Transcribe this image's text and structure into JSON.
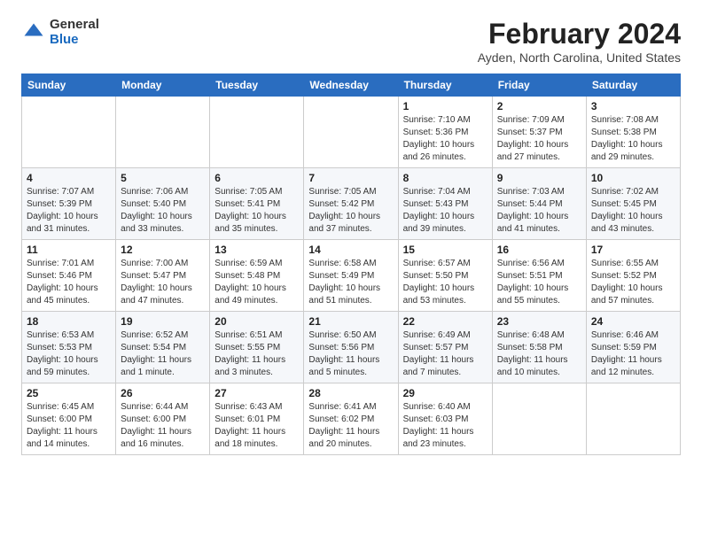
{
  "logo": {
    "general": "General",
    "blue": "Blue"
  },
  "title": "February 2024",
  "subtitle": "Ayden, North Carolina, United States",
  "days_of_week": [
    "Sunday",
    "Monday",
    "Tuesday",
    "Wednesday",
    "Thursday",
    "Friday",
    "Saturday"
  ],
  "weeks": [
    [
      {
        "day": "",
        "sunrise": "",
        "sunset": "",
        "daylight": ""
      },
      {
        "day": "",
        "sunrise": "",
        "sunset": "",
        "daylight": ""
      },
      {
        "day": "",
        "sunrise": "",
        "sunset": "",
        "daylight": ""
      },
      {
        "day": "",
        "sunrise": "",
        "sunset": "",
        "daylight": ""
      },
      {
        "day": "1",
        "sunrise": "Sunrise: 7:10 AM",
        "sunset": "Sunset: 5:36 PM",
        "daylight": "Daylight: 10 hours and 26 minutes."
      },
      {
        "day": "2",
        "sunrise": "Sunrise: 7:09 AM",
        "sunset": "Sunset: 5:37 PM",
        "daylight": "Daylight: 10 hours and 27 minutes."
      },
      {
        "day": "3",
        "sunrise": "Sunrise: 7:08 AM",
        "sunset": "Sunset: 5:38 PM",
        "daylight": "Daylight: 10 hours and 29 minutes."
      }
    ],
    [
      {
        "day": "4",
        "sunrise": "Sunrise: 7:07 AM",
        "sunset": "Sunset: 5:39 PM",
        "daylight": "Daylight: 10 hours and 31 minutes."
      },
      {
        "day": "5",
        "sunrise": "Sunrise: 7:06 AM",
        "sunset": "Sunset: 5:40 PM",
        "daylight": "Daylight: 10 hours and 33 minutes."
      },
      {
        "day": "6",
        "sunrise": "Sunrise: 7:05 AM",
        "sunset": "Sunset: 5:41 PM",
        "daylight": "Daylight: 10 hours and 35 minutes."
      },
      {
        "day": "7",
        "sunrise": "Sunrise: 7:05 AM",
        "sunset": "Sunset: 5:42 PM",
        "daylight": "Daylight: 10 hours and 37 minutes."
      },
      {
        "day": "8",
        "sunrise": "Sunrise: 7:04 AM",
        "sunset": "Sunset: 5:43 PM",
        "daylight": "Daylight: 10 hours and 39 minutes."
      },
      {
        "day": "9",
        "sunrise": "Sunrise: 7:03 AM",
        "sunset": "Sunset: 5:44 PM",
        "daylight": "Daylight: 10 hours and 41 minutes."
      },
      {
        "day": "10",
        "sunrise": "Sunrise: 7:02 AM",
        "sunset": "Sunset: 5:45 PM",
        "daylight": "Daylight: 10 hours and 43 minutes."
      }
    ],
    [
      {
        "day": "11",
        "sunrise": "Sunrise: 7:01 AM",
        "sunset": "Sunset: 5:46 PM",
        "daylight": "Daylight: 10 hours and 45 minutes."
      },
      {
        "day": "12",
        "sunrise": "Sunrise: 7:00 AM",
        "sunset": "Sunset: 5:47 PM",
        "daylight": "Daylight: 10 hours and 47 minutes."
      },
      {
        "day": "13",
        "sunrise": "Sunrise: 6:59 AM",
        "sunset": "Sunset: 5:48 PM",
        "daylight": "Daylight: 10 hours and 49 minutes."
      },
      {
        "day": "14",
        "sunrise": "Sunrise: 6:58 AM",
        "sunset": "Sunset: 5:49 PM",
        "daylight": "Daylight: 10 hours and 51 minutes."
      },
      {
        "day": "15",
        "sunrise": "Sunrise: 6:57 AM",
        "sunset": "Sunset: 5:50 PM",
        "daylight": "Daylight: 10 hours and 53 minutes."
      },
      {
        "day": "16",
        "sunrise": "Sunrise: 6:56 AM",
        "sunset": "Sunset: 5:51 PM",
        "daylight": "Daylight: 10 hours and 55 minutes."
      },
      {
        "day": "17",
        "sunrise": "Sunrise: 6:55 AM",
        "sunset": "Sunset: 5:52 PM",
        "daylight": "Daylight: 10 hours and 57 minutes."
      }
    ],
    [
      {
        "day": "18",
        "sunrise": "Sunrise: 6:53 AM",
        "sunset": "Sunset: 5:53 PM",
        "daylight": "Daylight: 10 hours and 59 minutes."
      },
      {
        "day": "19",
        "sunrise": "Sunrise: 6:52 AM",
        "sunset": "Sunset: 5:54 PM",
        "daylight": "Daylight: 11 hours and 1 minute."
      },
      {
        "day": "20",
        "sunrise": "Sunrise: 6:51 AM",
        "sunset": "Sunset: 5:55 PM",
        "daylight": "Daylight: 11 hours and 3 minutes."
      },
      {
        "day": "21",
        "sunrise": "Sunrise: 6:50 AM",
        "sunset": "Sunset: 5:56 PM",
        "daylight": "Daylight: 11 hours and 5 minutes."
      },
      {
        "day": "22",
        "sunrise": "Sunrise: 6:49 AM",
        "sunset": "Sunset: 5:57 PM",
        "daylight": "Daylight: 11 hours and 7 minutes."
      },
      {
        "day": "23",
        "sunrise": "Sunrise: 6:48 AM",
        "sunset": "Sunset: 5:58 PM",
        "daylight": "Daylight: 11 hours and 10 minutes."
      },
      {
        "day": "24",
        "sunrise": "Sunrise: 6:46 AM",
        "sunset": "Sunset: 5:59 PM",
        "daylight": "Daylight: 11 hours and 12 minutes."
      }
    ],
    [
      {
        "day": "25",
        "sunrise": "Sunrise: 6:45 AM",
        "sunset": "Sunset: 6:00 PM",
        "daylight": "Daylight: 11 hours and 14 minutes."
      },
      {
        "day": "26",
        "sunrise": "Sunrise: 6:44 AM",
        "sunset": "Sunset: 6:00 PM",
        "daylight": "Daylight: 11 hours and 16 minutes."
      },
      {
        "day": "27",
        "sunrise": "Sunrise: 6:43 AM",
        "sunset": "Sunset: 6:01 PM",
        "daylight": "Daylight: 11 hours and 18 minutes."
      },
      {
        "day": "28",
        "sunrise": "Sunrise: 6:41 AM",
        "sunset": "Sunset: 6:02 PM",
        "daylight": "Daylight: 11 hours and 20 minutes."
      },
      {
        "day": "29",
        "sunrise": "Sunrise: 6:40 AM",
        "sunset": "Sunset: 6:03 PM",
        "daylight": "Daylight: 11 hours and 23 minutes."
      },
      {
        "day": "",
        "sunrise": "",
        "sunset": "",
        "daylight": ""
      },
      {
        "day": "",
        "sunrise": "",
        "sunset": "",
        "daylight": ""
      }
    ]
  ]
}
